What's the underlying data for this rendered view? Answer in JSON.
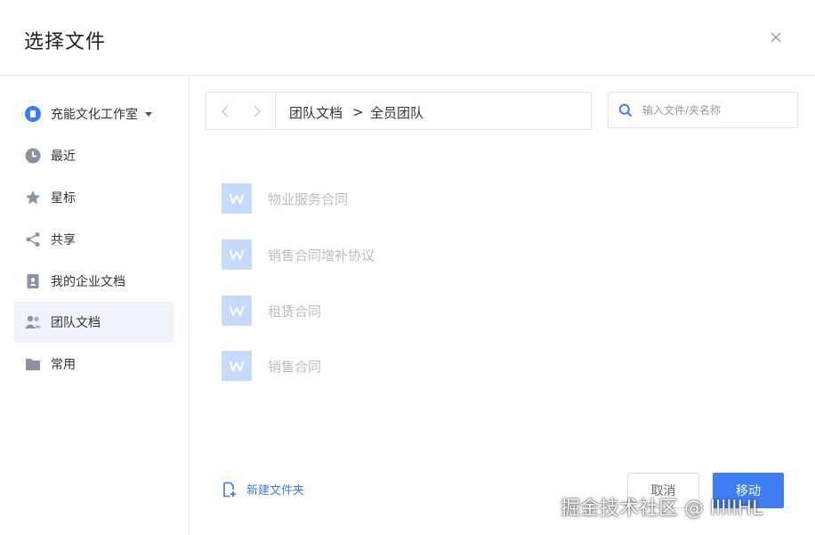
{
  "dialog": {
    "title": "选择文件"
  },
  "sidebar": {
    "workspace": {
      "label": "充能文化工作室"
    },
    "items": [
      {
        "label": "最近",
        "icon": "clock-icon"
      },
      {
        "label": "星标",
        "icon": "star-icon"
      },
      {
        "label": "共享",
        "icon": "share-icon"
      },
      {
        "label": "我的企业文档",
        "icon": "person-doc-icon"
      },
      {
        "label": "团队文档",
        "icon": "team-icon",
        "active": true
      },
      {
        "label": "常用",
        "icon": "folder-icon"
      }
    ]
  },
  "breadcrumb": {
    "root": "团队文档",
    "separator": ">",
    "current": "全员团队"
  },
  "search": {
    "placeholder": "输入文件/夹名称",
    "value": ""
  },
  "files": [
    {
      "name": "物业服务合同"
    },
    {
      "name": "销售合同增补协议"
    },
    {
      "name": "租赁合同"
    },
    {
      "name": "销售合同"
    }
  ],
  "footer": {
    "new_folder_label": "新建文件夹",
    "cancel_label": "取消",
    "move_label": "移动"
  },
  "watermark": "掘金技术社区 @ lllllHL",
  "colors": {
    "accent": "#3f7df5",
    "file_icon_bg": "#c6dafc",
    "active_bg": "#f0f4fa"
  }
}
